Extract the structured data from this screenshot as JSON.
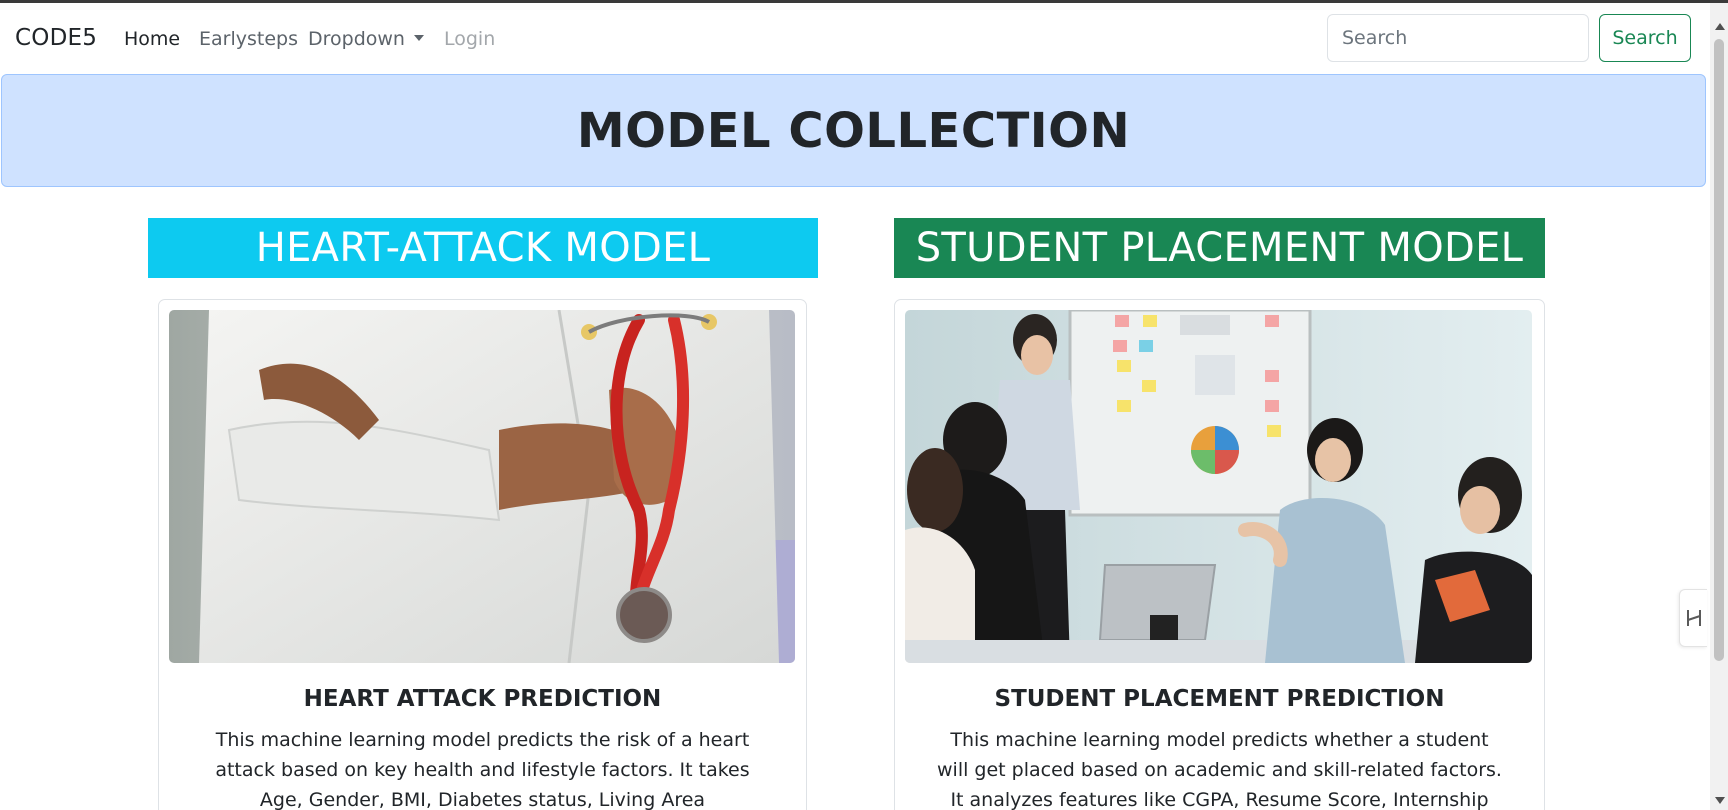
{
  "navbar": {
    "brand": "CODE5",
    "links": [
      {
        "label": "Home"
      },
      {
        "label": "Earlysteps"
      },
      {
        "label": "Dropdown"
      },
      {
        "label": "Login"
      }
    ],
    "search": {
      "placeholder": "Search",
      "value": "",
      "button_label": "Search"
    }
  },
  "hero": {
    "title": "MODEL COLLECTION"
  },
  "models": [
    {
      "header": "HEART-ATTACK MODEL",
      "header_color": "#0dcaf0",
      "card_title": "HEART ATTACK PREDICTION",
      "description": "This machine learning model predicts the risk of a heart attack based on key health and lifestyle factors. It takes Age, Gender, BMI, Diabetes status, Living Area (Urban/Rural), and Lifestyle"
    },
    {
      "header": "STUDENT PLACEMENT MODEL",
      "header_color": "#198754",
      "card_title": "STUDENT PLACEMENT PREDICTION",
      "description": "This machine learning model predicts whether a student will get placed based on academic and skill-related factors. It analyzes features like CGPA, Resume Score, Internship Experience,"
    }
  ],
  "icons": {
    "dropdown_caret": "caret-down-icon",
    "side_tab": "side-panel-toggle-icon"
  },
  "colors": {
    "hero_bg": "#cfe2ff",
    "success": "#198754",
    "info": "#0dcaf0"
  }
}
